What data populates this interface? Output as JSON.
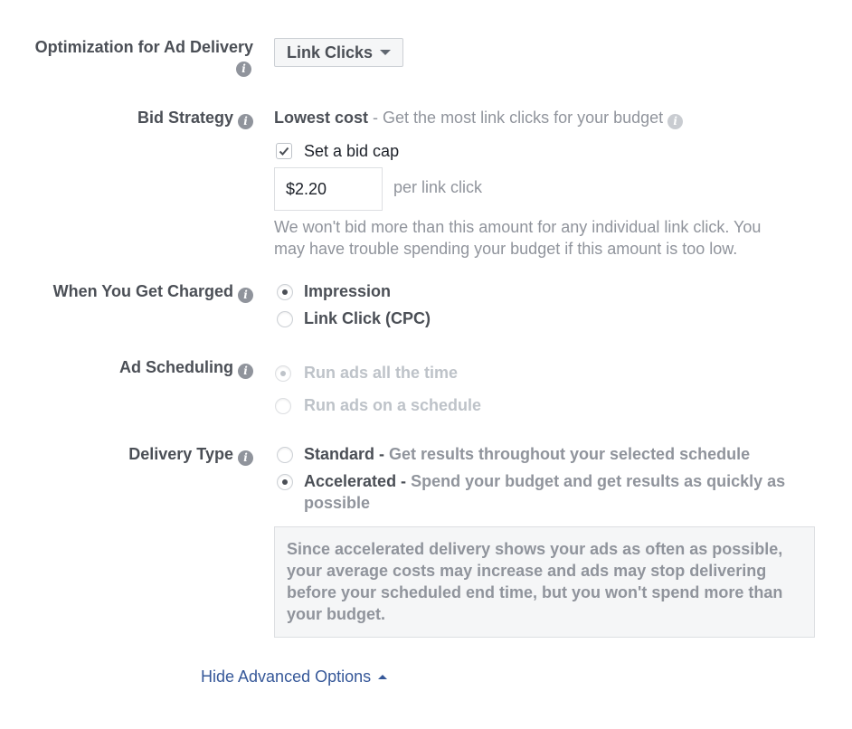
{
  "optimization": {
    "label": "Optimization for Ad Delivery",
    "info_icon": "info-icon",
    "dropdown_value": "Link Clicks"
  },
  "bid_strategy": {
    "label": "Bid Strategy",
    "strategy_name": "Lowest cost",
    "strategy_desc": " - Get the most link clicks for your budget",
    "bid_cap_label": "Set a bid cap",
    "bid_cap_checked": true,
    "bid_cap_value": "$2.20",
    "bid_cap_unit": "per link click",
    "help_line1": "We won't bid more than this amount for any individual link click. You",
    "help_line2": "may have trouble spending your budget if this amount is too low."
  },
  "charged": {
    "label": "When You Get Charged",
    "options": [
      {
        "label": "Impression",
        "checked": true
      },
      {
        "label": "Link Click (CPC)",
        "checked": false
      }
    ]
  },
  "scheduling": {
    "label": "Ad Scheduling",
    "options": [
      {
        "label": "Run ads all the time",
        "checked": true,
        "disabled": true
      },
      {
        "label": "Run ads on a schedule",
        "checked": false,
        "disabled": true
      }
    ]
  },
  "delivery": {
    "label": "Delivery Type",
    "options": [
      {
        "name": "Standard -",
        "desc": " Get results throughout your selected schedule",
        "checked": false
      },
      {
        "name": "Accelerated -",
        "desc": " Spend your budget and get results as quickly as",
        "desc2": "possible",
        "checked": true
      }
    ],
    "notice": "Since accelerated delivery shows your ads as often as possible, your average costs may increase and ads may stop delivering before your scheduled end time, but you won't spend more than your budget."
  },
  "footer": {
    "hide_advanced_label": "Hide Advanced Options"
  },
  "colors": {
    "link": "#365899",
    "label": "#4b4f56",
    "muted": "#90949c"
  }
}
